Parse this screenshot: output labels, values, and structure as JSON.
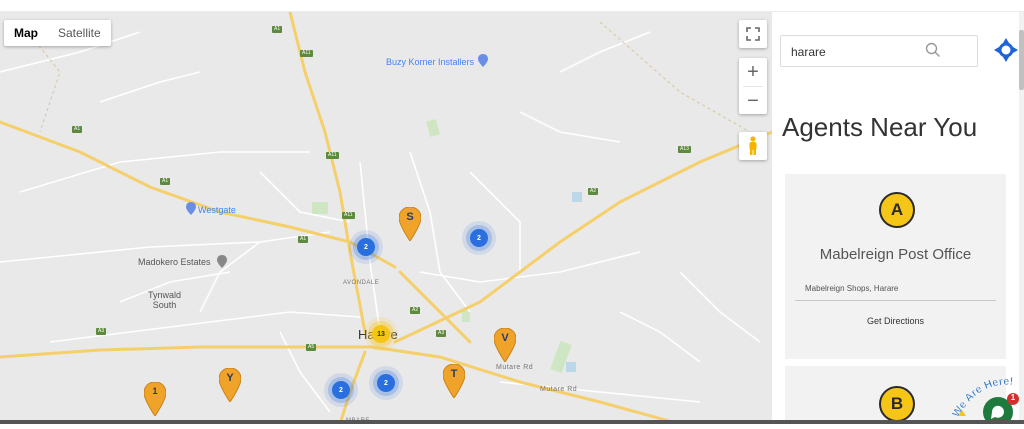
{
  "map": {
    "type_control": {
      "map_label": "Map",
      "satellite_label": "Satellite",
      "selected": "Map"
    },
    "zoom": {
      "in_label": "+",
      "out_label": "−"
    },
    "labels": {
      "buzy_korner": "Buzy Korner Installers",
      "westgate": "Westgate",
      "madokero": "Madokero Estates",
      "tynwald": "Tynwald\nSouth",
      "avondale": "AVONDALE",
      "harare": "Harare",
      "mutare_rd_1": "Mutare Rd",
      "mutare_rd_2": "Mutare Rd",
      "mbare": "MBARE"
    },
    "road_shields": [
      "A1",
      "A11",
      "A1",
      "A11",
      "A1",
      "A1",
      "A11",
      "A5",
      "A3",
      "A13",
      "A2",
      "A2",
      "A3"
    ],
    "pins": [
      {
        "letter": "S",
        "label": "S"
      },
      {
        "letter": "V",
        "label": "V"
      },
      {
        "letter": "Y",
        "label": "Y"
      },
      {
        "letter": "T",
        "label": "T"
      },
      {
        "letter": "1",
        "label": "1"
      }
    ],
    "clusters": [
      {
        "count": "2"
      },
      {
        "count": "2"
      },
      {
        "count": "13"
      },
      {
        "count": "2"
      },
      {
        "count": "2"
      }
    ]
  },
  "sidebar": {
    "search": {
      "value": "harare",
      "placeholder": ""
    },
    "heading": "Agents Near You",
    "agents": [
      {
        "badge": "A",
        "name": "Mabelreign Post Office",
        "address": "Mabelreign Shops, Harare",
        "directions_label": "Get Directions"
      },
      {
        "badge": "B"
      }
    ]
  },
  "chat": {
    "banner": "We Are Here!",
    "unread": "1"
  },
  "colors": {
    "pin": "#f0a329",
    "cluster": "#2a6fe0",
    "accent": "#1e64d8",
    "badge": "#f5c518",
    "map_bg": "#e9e9e9",
    "road_major": "#f5cf6a"
  }
}
